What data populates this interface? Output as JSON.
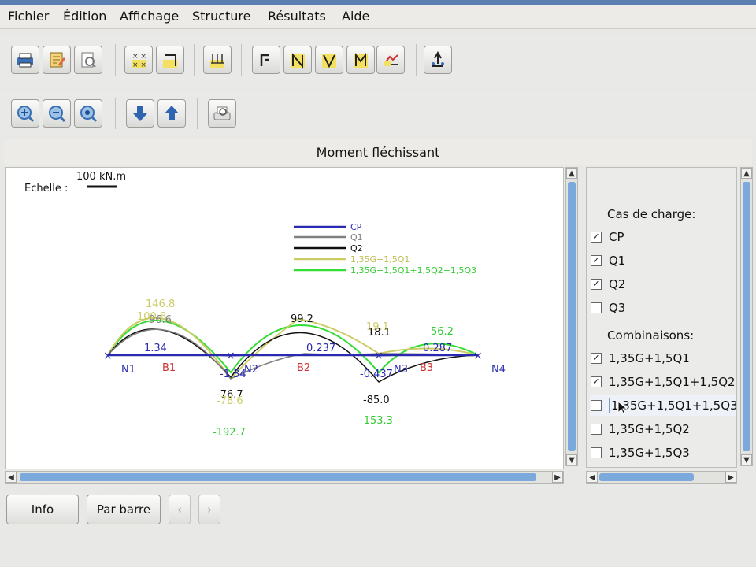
{
  "menu": [
    "Fichier",
    "Édition",
    "Affichage",
    "Structure",
    "Résultats",
    "Aide"
  ],
  "toolbar1": [
    "print-icon",
    "edit-icon",
    "preview-icon",
    "nodes-icon",
    "support-icon",
    "load-icon",
    "normal-force-icon",
    "shear-icon",
    "shear-v-icon",
    "moment-icon",
    "deformed-icon",
    "reactions-icon"
  ],
  "toolbar2": [
    "zoom-in-icon",
    "zoom-out-icon",
    "zoom-fit-icon",
    "arrow-down-icon",
    "arrow-up-icon",
    "printer-preview-icon"
  ],
  "view_title": "Moment fléchissant",
  "scale": {
    "label": "Echelle :",
    "unit_text": "100 kN.m"
  },
  "legend": [
    {
      "name": "CP",
      "color": "#2a2ab0"
    },
    {
      "name": "Q1",
      "color": "#808080"
    },
    {
      "name": "Q2",
      "color": "#111111"
    },
    {
      "name": "1,35G+1,5Q1",
      "color": "#cccc66"
    },
    {
      "name": "1,35G+1,5Q1+1,5Q2+1,5Q3",
      "color": "#33dd33"
    }
  ],
  "nodes": [
    "N1",
    "N2",
    "N3",
    "N4"
  ],
  "bars": [
    "B1",
    "B2",
    "B3"
  ],
  "diagram_labels": {
    "cp_span1": "1.34",
    "cp_span2": "0.237",
    "cp_span3": "0.287",
    "cp_support1": "-1.34",
    "cp_support2": "-0.437",
    "q1_span1": "96.6",
    "comb1_span1": "146.8",
    "comb_all_span1": "100.8",
    "q2_span2": "99.2",
    "q2_span3": "18.1",
    "comb1_span3": "19.1",
    "comb_all_span3": "56.2",
    "q2_support1": "-76.7",
    "comb1_support1": "-78.6",
    "q2_support2": "-85.0",
    "comb_all_support1": "-192.7",
    "comb_all_support2": "-153.3"
  },
  "panel": {
    "load_cases_title": "Cas de charge:",
    "load_cases": [
      {
        "label": "CP",
        "checked": true
      },
      {
        "label": "Q1",
        "checked": true
      },
      {
        "label": "Q2",
        "checked": true
      },
      {
        "label": "Q3",
        "checked": false
      }
    ],
    "combos_title": "Combinaisons:",
    "combos": [
      {
        "label": "1,35G+1,5Q1",
        "checked": true
      },
      {
        "label": "1,35G+1,5Q1+1,5Q2",
        "checked": true
      },
      {
        "label": "1,35G+1,5Q1+1,5Q3",
        "checked": false
      },
      {
        "label": "1,35G+1,5Q2",
        "checked": false
      },
      {
        "label": "1,35G+1,5Q3",
        "checked": false
      }
    ]
  },
  "buttons": {
    "info": "Info",
    "per_bar": "Par barre",
    "prev": "‹",
    "next": "›"
  },
  "colors": {
    "accent": "#7ba9db",
    "node_label": "#2a2ab0",
    "bar_label": "#cc3333"
  }
}
